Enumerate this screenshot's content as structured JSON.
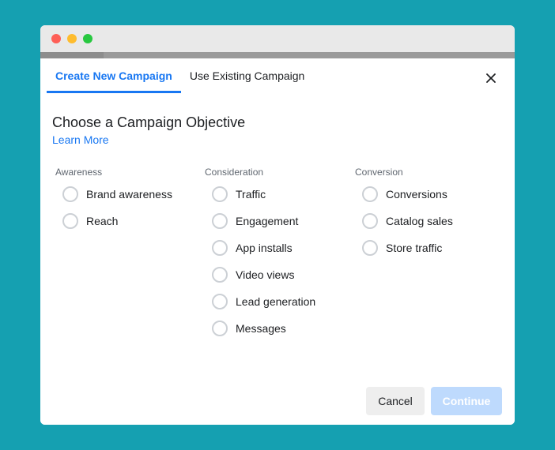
{
  "tabs": [
    {
      "label": "Create New Campaign",
      "active": true
    },
    {
      "label": "Use Existing Campaign",
      "active": false
    }
  ],
  "heading": "Choose a Campaign Objective",
  "learn_more": "Learn More",
  "columns": [
    {
      "title": "Awareness",
      "options": [
        "Brand awareness",
        "Reach"
      ]
    },
    {
      "title": "Consideration",
      "options": [
        "Traffic",
        "Engagement",
        "App installs",
        "Video views",
        "Lead generation",
        "Messages"
      ]
    },
    {
      "title": "Conversion",
      "options": [
        "Conversions",
        "Catalog sales",
        "Store traffic"
      ]
    }
  ],
  "buttons": {
    "cancel": "Cancel",
    "continue": "Continue",
    "continue_disabled": true
  },
  "colors": {
    "background": "#15a0b1",
    "accent": "#1877f2",
    "continue_disabled_bg": "#bedafd"
  },
  "icons": {
    "close": "close-icon"
  }
}
